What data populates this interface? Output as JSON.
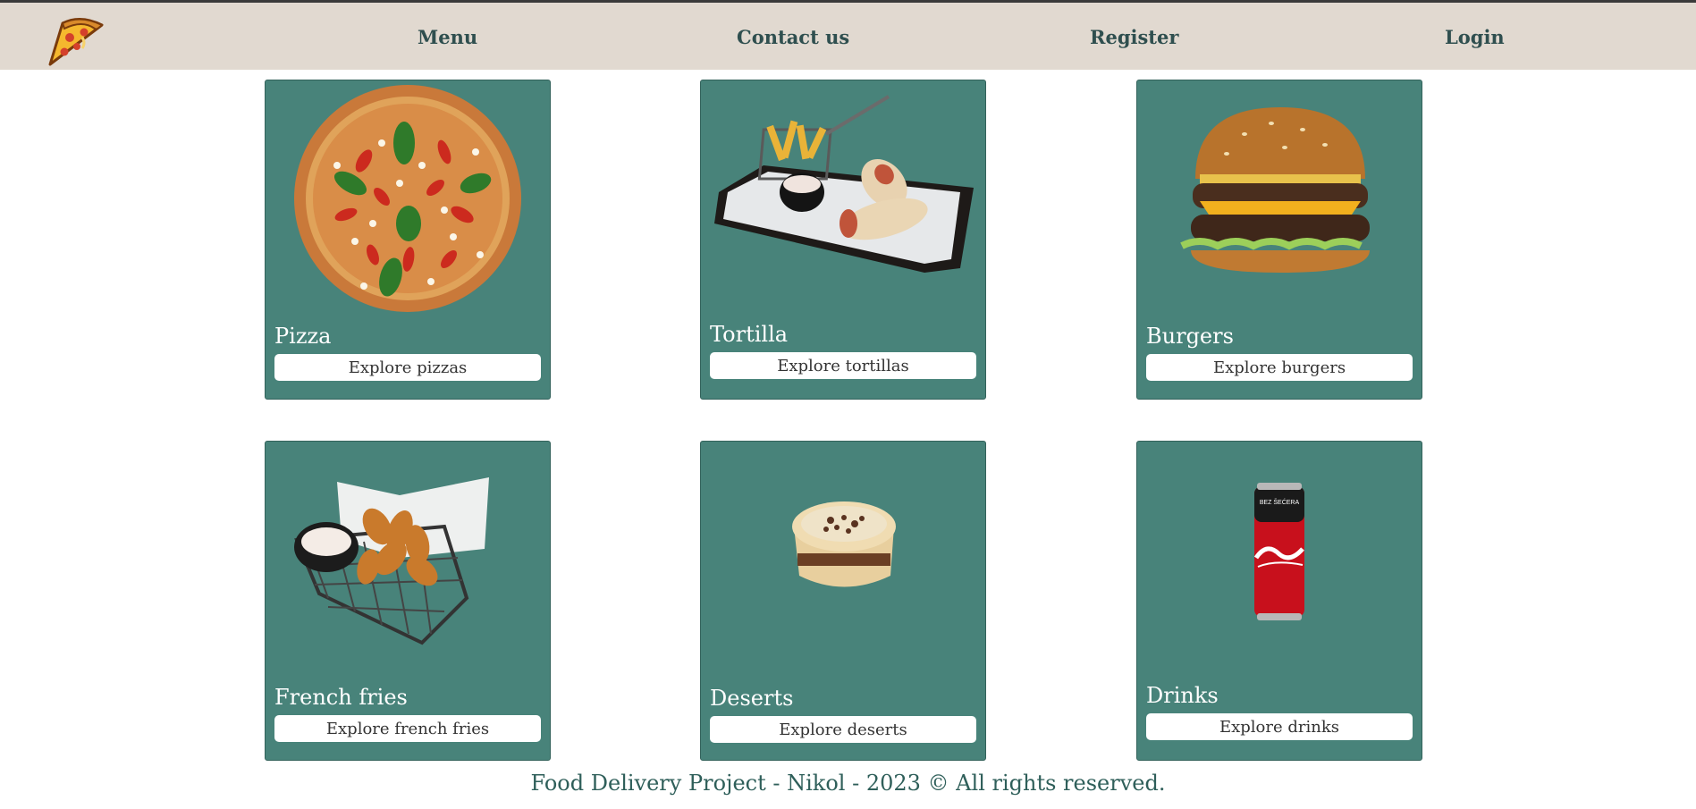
{
  "nav": {
    "logo": "pizza-logo-icon",
    "links": [
      "Menu",
      "Contact us",
      "Register",
      "Login"
    ]
  },
  "cards": [
    {
      "title": "Pizza",
      "button": "Explore pizzas",
      "image": "pizza-image"
    },
    {
      "title": "Tortilla",
      "button": "Explore tortillas",
      "image": "tortilla-image"
    },
    {
      "title": "Burgers",
      "button": "Explore burgers",
      "image": "burger-image"
    },
    {
      "title": "French fries",
      "button": "Explore french fries",
      "image": "fries-image"
    },
    {
      "title": "Deserts",
      "button": "Explore deserts",
      "image": "dessert-image"
    },
    {
      "title": "Drinks",
      "button": "Explore drinks",
      "image": "drink-can-image"
    }
  ],
  "footer": {
    "text": "Food Delivery Project - Nikol - 2023 © All rights reserved."
  },
  "colors": {
    "header_bg": "#e1d9d0",
    "card_bg": "#48837a",
    "nav_text": "#2f4f4f",
    "footer_text": "#2f5f5a"
  }
}
